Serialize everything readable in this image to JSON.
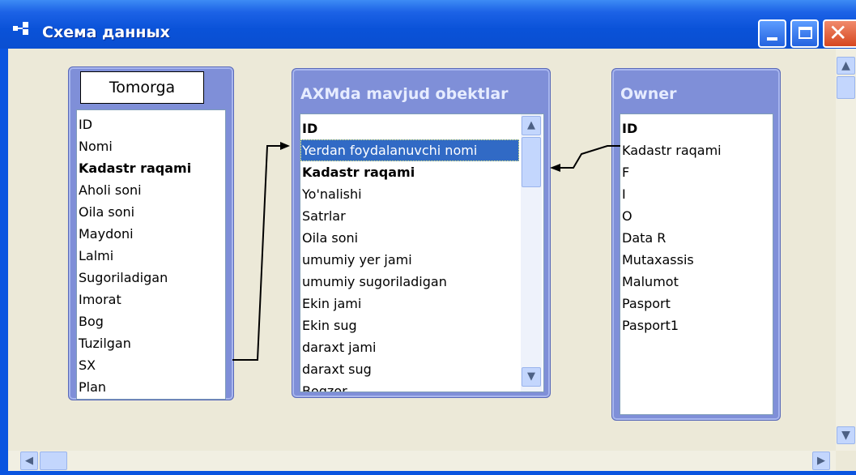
{
  "window": {
    "title": "Схема данных",
    "buttons": {
      "minimize": "minimize",
      "maximize": "maximize",
      "close": "close"
    }
  },
  "tables": {
    "tomorga": {
      "title": "Tomorga",
      "fields": [
        {
          "label": "ID",
          "key": false
        },
        {
          "label": "Nomi",
          "key": false
        },
        {
          "label": "Kadastr raqami",
          "key": true
        },
        {
          "label": "Aholi soni",
          "key": false
        },
        {
          "label": "Oila soni",
          "key": false
        },
        {
          "label": "Maydoni",
          "key": false
        },
        {
          "label": "Lalmi",
          "key": false
        },
        {
          "label": "Sugoriladigan",
          "key": false
        },
        {
          "label": "Imorat",
          "key": false
        },
        {
          "label": "Bog",
          "key": false
        },
        {
          "label": "Tuzilgan",
          "key": false
        },
        {
          "label": "SX",
          "key": false
        },
        {
          "label": "Plan",
          "key": false
        }
      ]
    },
    "axm": {
      "title": "AXMda mavjud obektlar",
      "fields": [
        {
          "label": "ID",
          "key": true
        },
        {
          "label": "Yerdan foydalanuvchi nomi",
          "key": false,
          "selected": true
        },
        {
          "label": "Kadastr raqami",
          "key": true
        },
        {
          "label": "Yo'nalishi",
          "key": false
        },
        {
          "label": "Satrlar",
          "key": false
        },
        {
          "label": "Oila soni",
          "key": false
        },
        {
          "label": "umumiy yer jami",
          "key": false
        },
        {
          "label": "umumiy sugoriladigan",
          "key": false
        },
        {
          "label": "Ekin jami",
          "key": false
        },
        {
          "label": "Ekin sug",
          "key": false
        },
        {
          "label": "daraxt jami",
          "key": false
        },
        {
          "label": "daraxt sug",
          "key": false
        },
        {
          "label": "Bogzor",
          "key": false
        }
      ]
    },
    "owner": {
      "title": "Owner",
      "fields": [
        {
          "label": "ID",
          "key": true
        },
        {
          "label": "Kadastr raqami",
          "key": false
        },
        {
          "label": "F",
          "key": false
        },
        {
          "label": "I",
          "key": false
        },
        {
          "label": "O",
          "key": false
        },
        {
          "label": "Data R",
          "key": false
        },
        {
          "label": "Mutaxassis",
          "key": false
        },
        {
          "label": "Malumot",
          "key": false
        },
        {
          "label": "Pasport",
          "key": false
        },
        {
          "label": "Pasport1",
          "key": false
        }
      ]
    }
  },
  "icons": {
    "up": "▲",
    "down": "▼",
    "left": "◀",
    "right": "▶",
    "close_glyph": "✕"
  },
  "colors": {
    "titlebar": "#0a52d8",
    "canvas": "#ece9d8",
    "table_frame": "#7f8fd8",
    "selection": "#316ac5"
  }
}
